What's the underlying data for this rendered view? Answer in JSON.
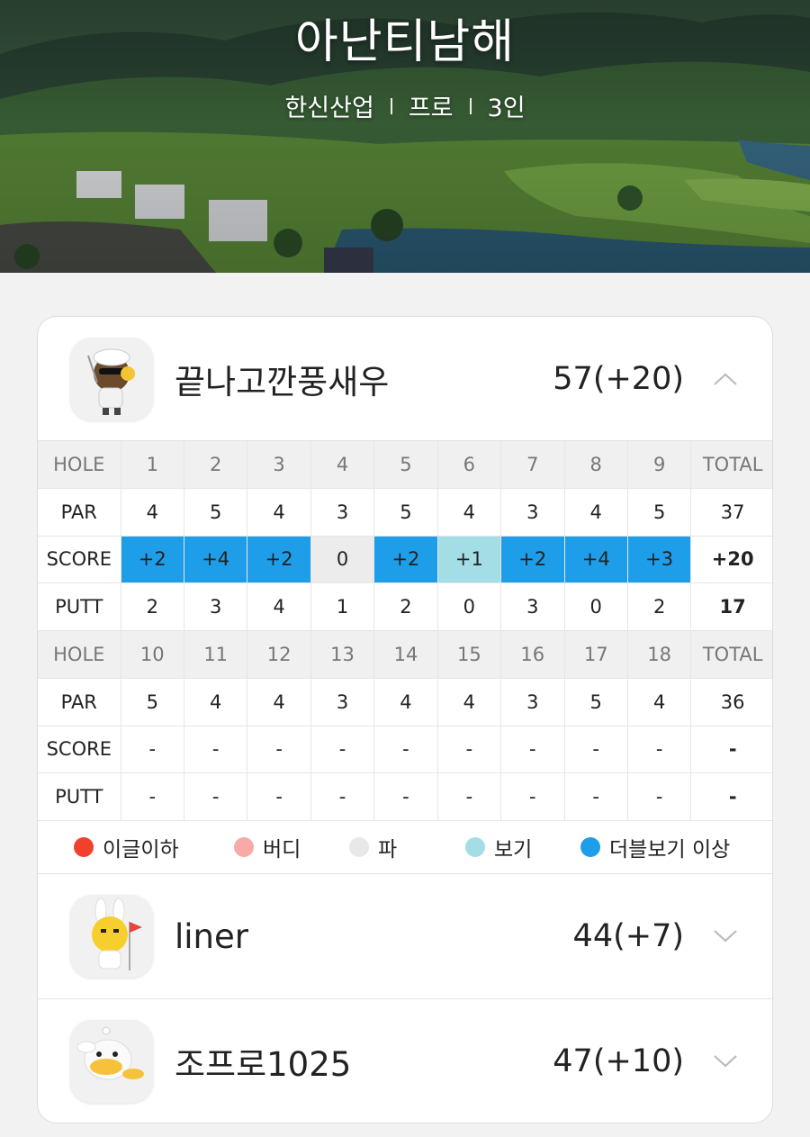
{
  "header": {
    "course_name": "아난티남해",
    "sub_items": [
      "한신산업",
      "프로",
      "3인"
    ]
  },
  "players": [
    {
      "name": "끝나고깐풍새우",
      "score": "57(+20)",
      "expanded": true,
      "avatar_icon": "golfer-bear-icon"
    },
    {
      "name": "liner",
      "score": "44(+7)",
      "expanded": false,
      "avatar_icon": "bunny-golfer-icon"
    },
    {
      "name": "조프로1025",
      "score": "47(+10)",
      "expanded": false,
      "avatar_icon": "duck-golfer-icon"
    }
  ],
  "scorecard": {
    "row_labels": {
      "hole": "HOLE",
      "par": "PAR",
      "score": "SCORE",
      "putt": "PUTT",
      "total": "TOTAL"
    },
    "front": {
      "holes": [
        "1",
        "2",
        "3",
        "4",
        "5",
        "6",
        "7",
        "8",
        "9"
      ],
      "par": [
        "4",
        "5",
        "4",
        "3",
        "5",
        "4",
        "3",
        "4",
        "5"
      ],
      "par_total": "37",
      "score": [
        "+2",
        "+4",
        "+2",
        "0",
        "+2",
        "+1",
        "+2",
        "+4",
        "+3"
      ],
      "score_total": "+20",
      "putt": [
        "2",
        "3",
        "4",
        "1",
        "2",
        "0",
        "3",
        "0",
        "2"
      ],
      "putt_total": "17"
    },
    "back": {
      "holes": [
        "10",
        "11",
        "12",
        "13",
        "14",
        "15",
        "16",
        "17",
        "18"
      ],
      "par": [
        "5",
        "4",
        "4",
        "3",
        "4",
        "4",
        "3",
        "5",
        "4"
      ],
      "par_total": "36",
      "score": [
        "-",
        "-",
        "-",
        "-",
        "-",
        "-",
        "-",
        "-",
        "-"
      ],
      "score_total": "-",
      "putt": [
        "-",
        "-",
        "-",
        "-",
        "-",
        "-",
        "-",
        "-",
        "-"
      ],
      "putt_total": "-"
    }
  },
  "legend": [
    {
      "label": "이글이하",
      "color": "#f0412d"
    },
    {
      "label": "버디",
      "color": "#f7aaa8"
    },
    {
      "label": "파",
      "color": "#e8e8e8"
    },
    {
      "label": "보기",
      "color": "#a3dde6"
    },
    {
      "label": "더블보기 이상",
      "color": "#1e9ee8"
    }
  ],
  "colors": {
    "double_bogey_plus": "#1e9ee8",
    "bogey": "#a3dde6",
    "par": "#ececec",
    "birdie": "#f7aaa8",
    "eagle_or_better": "#f0412d"
  }
}
